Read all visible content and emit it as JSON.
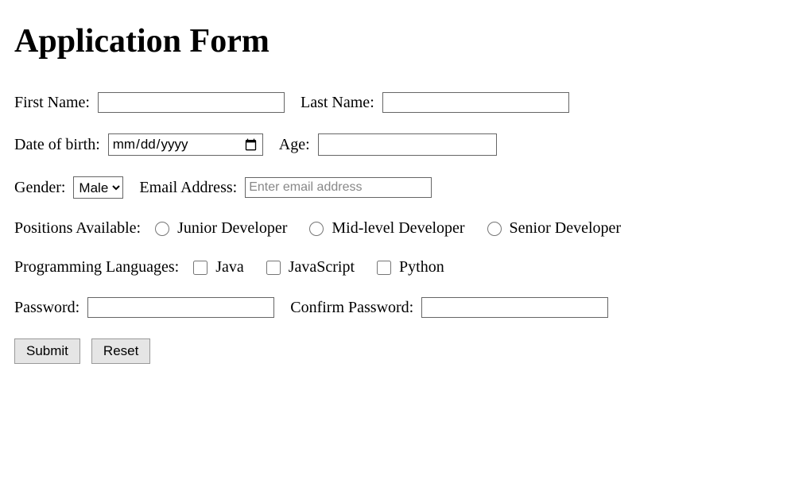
{
  "title": "Application Form",
  "fields": {
    "first_name_label": "First Name:",
    "last_name_label": "Last Name:",
    "dob_label": "Date of birth:",
    "dob_placeholder": "mm / dd / yyyy",
    "age_label": "Age:",
    "gender_label": "Gender:",
    "gender_selected": "Male",
    "email_label": "Email Address:",
    "email_placeholder": "Enter email address",
    "positions_label": "Positions Available:",
    "positions": {
      "junior": "Junior Developer",
      "mid": "Mid-level Developer",
      "senior": "Senior Developer"
    },
    "languages_label": "Programming Languages:",
    "languages": {
      "java": "Java",
      "javascript": "JavaScript",
      "python": "Python"
    },
    "password_label": "Password:",
    "confirm_password_label": "Confirm Password:"
  },
  "buttons": {
    "submit": "Submit",
    "reset": "Reset"
  }
}
